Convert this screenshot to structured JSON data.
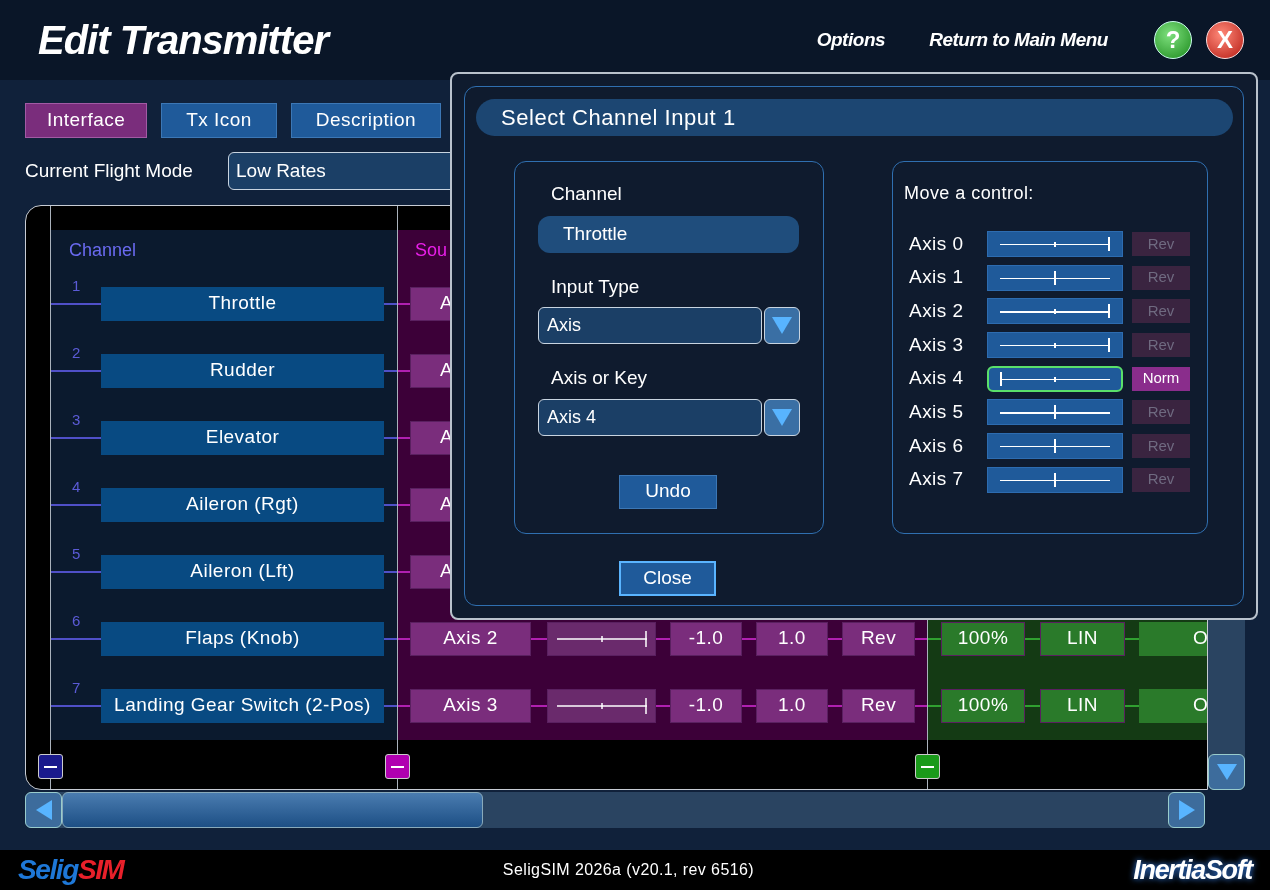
{
  "header": {
    "title": "Edit Transmitter",
    "links": [
      "Options",
      "Return to Main Menu"
    ],
    "help": "?",
    "close": "X"
  },
  "tabs": [
    {
      "label": "Interface",
      "selected": true
    },
    {
      "label": "Tx Icon",
      "selected": false
    },
    {
      "label": "Description",
      "selected": false
    }
  ],
  "flight_mode": {
    "label": "Current Flight Mode",
    "value": "Low Rates"
  },
  "table": {
    "columns": [
      "Channel",
      "Sou"
    ],
    "rows": [
      {
        "number": "1",
        "channel": "Throttle",
        "source": "A"
      },
      {
        "number": "2",
        "channel": "Rudder",
        "source": "A"
      },
      {
        "number": "3",
        "channel": "Elevator",
        "source": "A"
      },
      {
        "number": "4",
        "channel": "Aileron (Rgt)",
        "source": "A"
      },
      {
        "number": "5",
        "channel": "Aileron (Lft)",
        "source": "A"
      },
      {
        "number": "6",
        "channel": "Flaps (Knob)",
        "source": "Axis 2",
        "min": "-1.0",
        "max": "1.0",
        "rev": "Rev",
        "rate": "100%",
        "curve": "LIN",
        "column_10": "O"
      },
      {
        "number": "7",
        "channel": "Landing Gear Switch (2-Pos)",
        "source": "Axis 3",
        "min": "-1.0",
        "max": "1.0",
        "rev": "Rev",
        "rate": "100%",
        "curve": "LIN",
        "column_10": "O"
      }
    ]
  },
  "dialog": {
    "title": "Select Channel Input 1",
    "channel_label": "Channel",
    "channel": "Throttle",
    "input_type_label": "Input Type",
    "input_type": "Axis",
    "axis_or_key_label": "Axis or Key",
    "axis_or_key": "Axis 4",
    "undo": "Undo",
    "close": "Close",
    "controls_label": "Move a control:",
    "axes": [
      {
        "label": "Axis 0",
        "level": 1,
        "selected": false,
        "button": {
          "label": "Rev",
          "disabled": true
        }
      },
      {
        "label": "Axis 1",
        "level": 0.5,
        "selected": false,
        "button": {
          "label": "Rev",
          "disabled": true
        }
      },
      {
        "label": "Axis 2",
        "level": 1,
        "selected": false,
        "button": {
          "label": "Rev",
          "disabled": true
        }
      },
      {
        "label": "Axis 3",
        "level": 1,
        "selected": false,
        "button": {
          "label": "Rev",
          "disabled": true
        }
      },
      {
        "label": "Axis 4",
        "level": 0,
        "selected": true,
        "button": {
          "label": "Norm",
          "disabled": false
        }
      },
      {
        "label": "Axis 5",
        "level": 0.5,
        "selected": false,
        "button": {
          "label": "Rev",
          "disabled": true
        }
      },
      {
        "label": "Axis 6",
        "level": 0.5,
        "selected": false,
        "button": {
          "label": "Rev",
          "disabled": true
        }
      },
      {
        "label": "Axis 7",
        "level": 0.5,
        "selected": false,
        "button": {
          "label": "Rev",
          "disabled": true
        }
      }
    ]
  },
  "footer": {
    "logo": [
      "Selig",
      "SIM"
    ],
    "version": "SeligSIM 2026a (v20.1, rev 6516)",
    "brand": "InertiaSoft"
  }
}
